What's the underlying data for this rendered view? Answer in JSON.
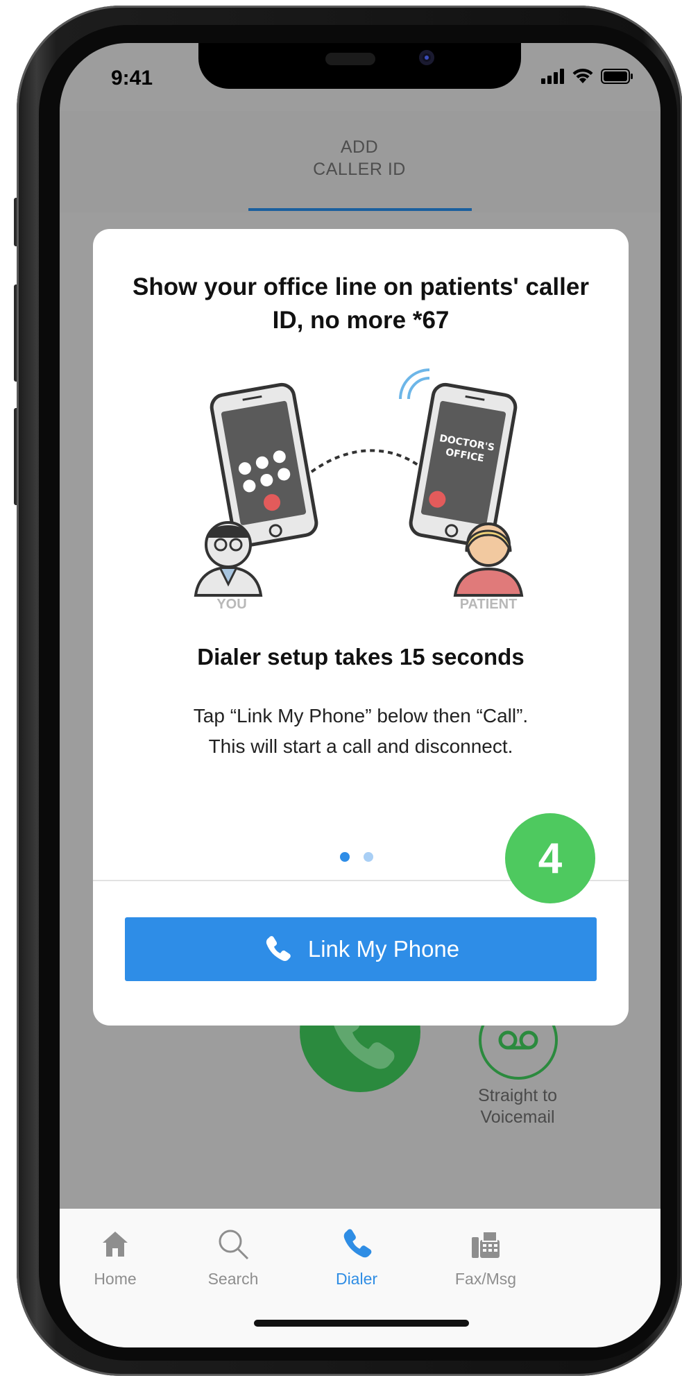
{
  "status_bar": {
    "time": "9:41"
  },
  "header": {
    "tab_label": "ADD\nCALLER ID"
  },
  "modal": {
    "title": "Show your office line on patients' caller ID, no more *67",
    "illustration": {
      "left_label": "YOU",
      "right_label": "PATIENT",
      "screen_text": "DOCTOR'S\nOFFICE"
    },
    "subtitle": "Dialer setup takes 15 seconds",
    "body": "Tap “Link My Phone” below then “Call”.\nThis will start a call and disconnect.",
    "pager": {
      "total": 2,
      "current": 1
    },
    "primary_button": "Link My Phone"
  },
  "background": {
    "voicemail_label": "Straight to\nVoicemail"
  },
  "tabbar": {
    "items": [
      {
        "label": "Home",
        "icon": "home-icon",
        "active": false
      },
      {
        "label": "Search",
        "icon": "search-icon",
        "active": false
      },
      {
        "label": "Dialer",
        "icon": "phone-icon",
        "active": true
      },
      {
        "label": "Fax/Msg",
        "icon": "fax-icon",
        "active": false
      }
    ]
  },
  "step_badge": "4",
  "colors": {
    "accent": "#2e8de7",
    "call_green": "#2b8a3e",
    "badge_green": "#4ec95f",
    "dimmed_overlay": "#9d9d9d"
  }
}
